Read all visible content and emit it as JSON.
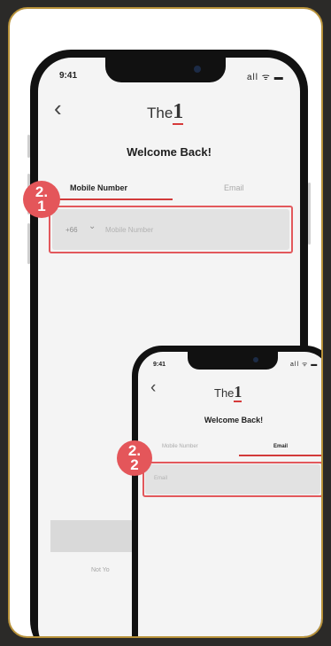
{
  "phone_primary": {
    "time": "9:41",
    "status_icons": "all ᯤ ▬",
    "brand": {
      "text": "The",
      "mark": "1"
    },
    "title": "Welcome Back!",
    "tabs": [
      "Mobile Number",
      "Email"
    ],
    "country_code": "+66",
    "chevron": "⌄",
    "placeholder": "Mobile Number",
    "step": {
      "line1": "2.",
      "line2": "1"
    },
    "bottom_link": "Not Yo"
  },
  "phone_secondary": {
    "time": "9:41",
    "status_icons": "all ᯤ ▬",
    "brand": {
      "text": "The",
      "mark": "1"
    },
    "title": "Welcome Back!",
    "tabs": [
      "Mobile Number",
      "Email"
    ],
    "placeholder": "Email",
    "step": {
      "line1": "2.",
      "line2": "2"
    }
  },
  "colors": {
    "frame": "#b8923a",
    "accent": "#e4565a",
    "background": "#2b2a28"
  },
  "icons": {
    "back": "‹"
  }
}
